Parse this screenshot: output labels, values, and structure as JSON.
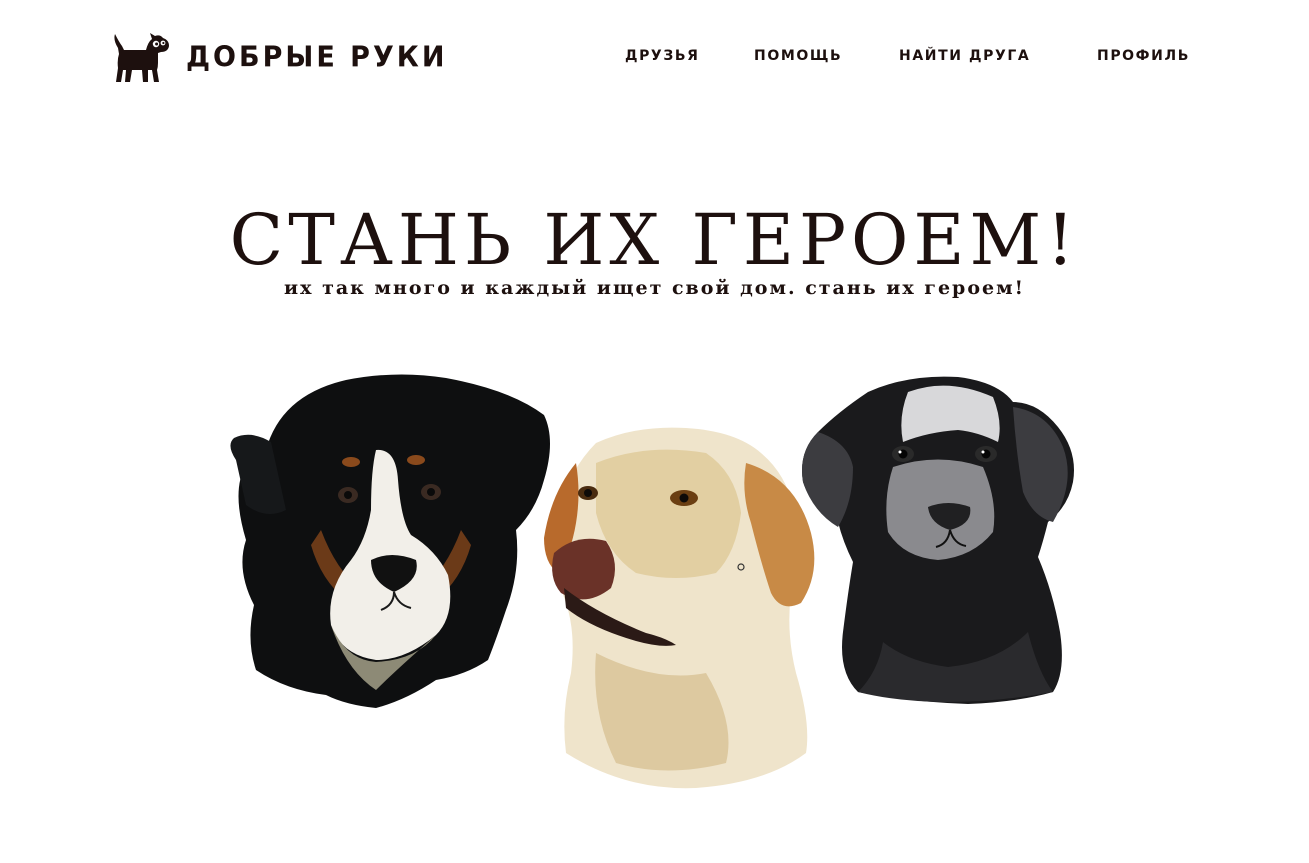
{
  "header": {
    "logo_text": "ДОБРЫЕ РУКИ",
    "logo_icon": "dog-icon",
    "nav": [
      {
        "label": "ДРУЗЬЯ"
      },
      {
        "label": "ПОМОЩЬ"
      },
      {
        "label": "НАЙТИ ДРУГА"
      },
      {
        "label": "ПРОФИЛЬ"
      }
    ]
  },
  "hero": {
    "title": "СТАНЬ ИХ ГЕРОЕМ!",
    "subtitle": "их так много и каждый ищет свой дом. стань их героем!"
  },
  "gallery": {
    "images": [
      {
        "name": "bernese-mountain-dog-watercolor"
      },
      {
        "name": "yellow-labrador-watercolor"
      },
      {
        "name": "black-labrador-puppy-watercolor"
      }
    ]
  },
  "colors": {
    "text": "#1d100e",
    "background": "#ffffff"
  }
}
